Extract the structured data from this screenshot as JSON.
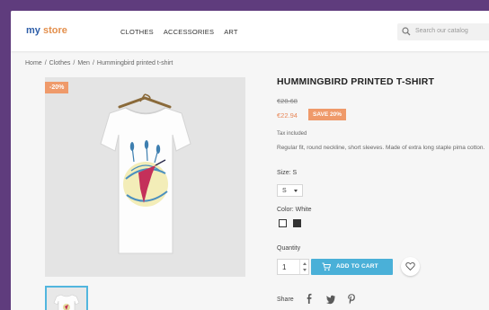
{
  "header": {
    "logo_main": "my ",
    "logo_accent": "store",
    "nav": [
      "CLOTHES",
      "ACCESSORIES",
      "ART"
    ],
    "search_placeholder": "Search our catalog"
  },
  "breadcrumb": [
    "Home",
    "/",
    "Clothes",
    "/",
    "Men",
    "/",
    "Hummingbird printed t-shirt"
  ],
  "product": {
    "discount_badge": "-20%",
    "title": "HUMMINGBIRD PRINTED T-SHIRT",
    "old_price": "€28.68",
    "new_price": "€22.94",
    "save_label": "SAVE 20%",
    "tax_text": "Tax included",
    "description": "Regular fit, round neckline, short sleeves. Made of extra long staple pima cotton.",
    "size_label": "Size: S",
    "size_value": "S",
    "color_label": "Color: White",
    "colors": [
      "#ffffff",
      "#333333"
    ],
    "quantity_label": "Quantity",
    "quantity_value": "1",
    "add_to_cart_label": "ADD TO CART",
    "share_label": "Share"
  },
  "icons": {
    "search": "search-icon",
    "cart": "cart-icon",
    "heart": "heart-icon",
    "facebook": "facebook-icon",
    "twitter": "twitter-icon",
    "pinterest": "pinterest-icon"
  },
  "colors": {
    "background": "#5f3c7d",
    "accent_blue": "#4ab0d8",
    "discount_orange": "#ef9a6a",
    "logo_blue": "#2e5ea8"
  }
}
